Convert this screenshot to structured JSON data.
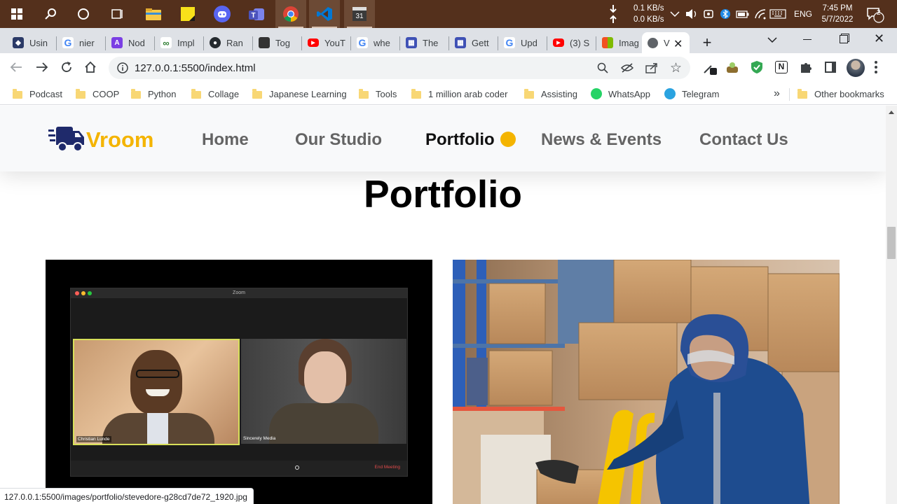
{
  "taskbar": {
    "net_down": "0.1 KB/s",
    "net_up": "0.0 KB/s",
    "language": "ENG",
    "time": "7:45 PM",
    "date": "5/7/2022",
    "notification_count": "2"
  },
  "browser": {
    "tabs": [
      {
        "label": "Usin",
        "icon": "dev-logo-icon",
        "color": "#2b3a67"
      },
      {
        "label": "nier",
        "icon": "google-icon",
        "color": "#4285f4"
      },
      {
        "label": "Nod",
        "icon": "app-logo-icon",
        "color": "#7b3fe4"
      },
      {
        "label": "Impl",
        "icon": "link-icon",
        "color": "#2e7d32"
      },
      {
        "label": "Ran",
        "icon": "github-icon",
        "color": "#24292e"
      },
      {
        "label": "Tog",
        "icon": "avatar-icon",
        "color": "#333333"
      },
      {
        "label": "YouT",
        "icon": "youtube-icon",
        "color": "#ff0000"
      },
      {
        "label": "whe",
        "icon": "google-icon",
        "color": "#4285f4"
      },
      {
        "label": "The",
        "icon": "grid-icon",
        "color": "#3f51b5"
      },
      {
        "label": "Gett",
        "icon": "grid-icon",
        "color": "#3f51b5"
      },
      {
        "label": "Upd",
        "icon": "google-icon",
        "color": "#4285f4"
      },
      {
        "label": "(3) S",
        "icon": "youtube-icon",
        "color": "#ff0000"
      },
      {
        "label": "Imag",
        "icon": "microsoft-icon",
        "color": "#f25022"
      },
      {
        "label": "V",
        "icon": "globe-icon",
        "color": "#5f6368"
      }
    ],
    "url": "127.0.0.1:5500/index.html",
    "bookmarks": [
      {
        "label": "Podcast",
        "icon": "folder-icon"
      },
      {
        "label": "COOP",
        "icon": "folder-icon"
      },
      {
        "label": "Python",
        "icon": "folder-icon"
      },
      {
        "label": "Collage",
        "icon": "folder-icon"
      },
      {
        "label": "Japanese Learning",
        "icon": "folder-icon"
      },
      {
        "label": "Tools",
        "icon": "folder-icon"
      },
      {
        "label": "1 million arab coder",
        "icon": "folder-icon"
      },
      {
        "label": "Assisting",
        "icon": "folder-icon"
      },
      {
        "label": "WhatsApp",
        "icon": "whatsapp-icon"
      },
      {
        "label": "Telegram",
        "icon": "telegram-icon"
      }
    ],
    "overflow_label": "»",
    "other_bookmarks": "Other bookmarks",
    "status_url": "127.0.0.1:5500/images/portfolio/stevedore-g28cd7de72_1920.jpg"
  },
  "site": {
    "logo": "Vroom",
    "nav": [
      {
        "label": "Home",
        "active": false
      },
      {
        "label": "Our Studio",
        "active": false
      },
      {
        "label": "Portfolio",
        "active": true
      },
      {
        "label": "News & Events",
        "active": false
      },
      {
        "label": "Contact Us",
        "active": false
      }
    ],
    "heading": "Portfolio",
    "images": [
      {
        "title_bar": "Zoom",
        "person1": "Christian Lunde",
        "person2": "Sincerely Media",
        "end_button": "End Meeting"
      },
      {
        "subject": "warehouse worker"
      }
    ],
    "colors": {
      "brand": "#f4b400",
      "logo_truck": "#1f2a6b",
      "nav_text": "#646464"
    }
  }
}
